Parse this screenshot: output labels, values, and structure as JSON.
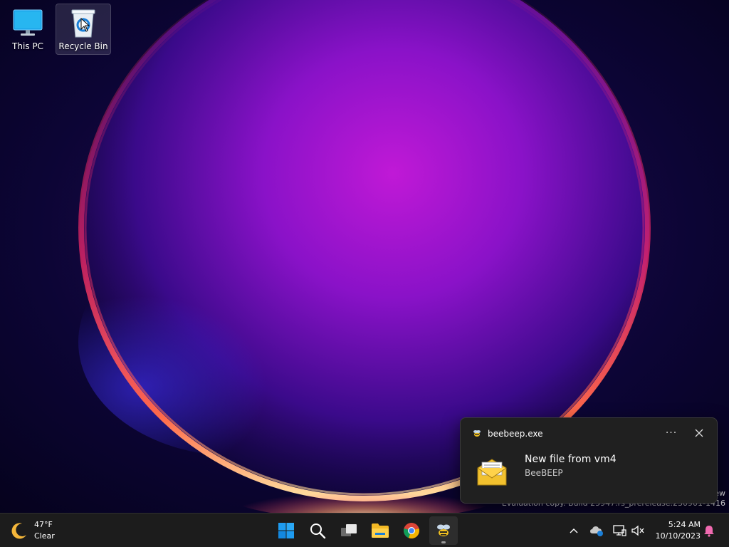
{
  "desktop": {
    "icons": [
      {
        "label": "This PC",
        "icon": "computer-icon"
      },
      {
        "label": "Recycle Bin",
        "icon": "recycle-bin-icon"
      }
    ],
    "watermark": {
      "line1": "ew",
      "line2": "Evaluation copy. Build 25947.rs_prerelease.230901-1416"
    }
  },
  "notification": {
    "app_name": "beebeep.exe",
    "title": "New file from vm4",
    "subtitle": "BeeBEEP",
    "more_label": "···",
    "icons": [
      "beebeep-app-icon",
      "more-icon",
      "close-icon",
      "envelope-icon"
    ]
  },
  "taskbar": {
    "weather": {
      "temperature": "47°F",
      "condition": "Clear",
      "icon": "moon-icon"
    },
    "apps": [
      {
        "name": "Start",
        "icon": "windows-start-icon"
      },
      {
        "name": "Search",
        "icon": "search-icon"
      },
      {
        "name": "Task View",
        "icon": "task-view-icon"
      },
      {
        "name": "File Explorer",
        "icon": "folder-icon"
      },
      {
        "name": "Google Chrome",
        "icon": "chrome-icon"
      },
      {
        "name": "BeeBEEP",
        "icon": "beebeep-icon",
        "active": true
      }
    ],
    "tray": [
      "chevron-up-icon",
      "onedrive-icon",
      "network-icon",
      "volume-muted-icon"
    ],
    "clock": {
      "time": "5:24 AM",
      "date": "10/10/2023"
    },
    "notification_icon": "bell-icon"
  },
  "colors": {
    "taskbar_bg": "#1c1c1c",
    "toast_bg": "#202020",
    "accent_blue": "#0078d4"
  }
}
